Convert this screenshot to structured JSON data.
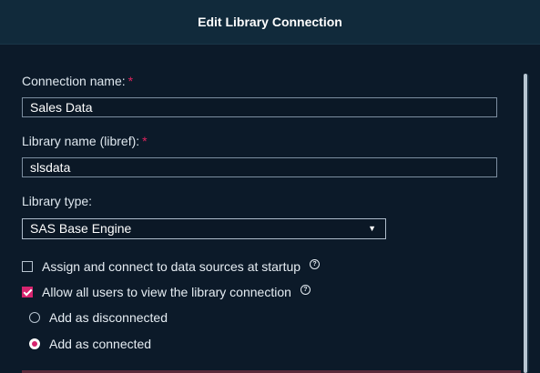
{
  "dialog": {
    "title": "Edit Library Connection"
  },
  "form": {
    "connection_name": {
      "label": "Connection name:",
      "required_mark": "*",
      "value": "Sales Data"
    },
    "libref": {
      "label": "Library name (libref):",
      "required_mark": "*",
      "value": "slsdata"
    },
    "library_type": {
      "label": "Library type:",
      "selected": "SAS Base Engine",
      "arrow": "▼"
    },
    "assign_connect": {
      "label": "Assign and connect to data sources at startup",
      "checked": false,
      "help": "?"
    },
    "allow_all_users": {
      "label": "Allow all users to view the library connection",
      "checked": true,
      "help": "?"
    },
    "connection_mode": {
      "options": [
        {
          "label": "Add as disconnected",
          "selected": false
        },
        {
          "label": "Add as connected",
          "selected": true
        }
      ]
    }
  },
  "colors": {
    "accent": "#d6246e",
    "background": "#0c1a29",
    "title_bar": "#112a3b"
  }
}
